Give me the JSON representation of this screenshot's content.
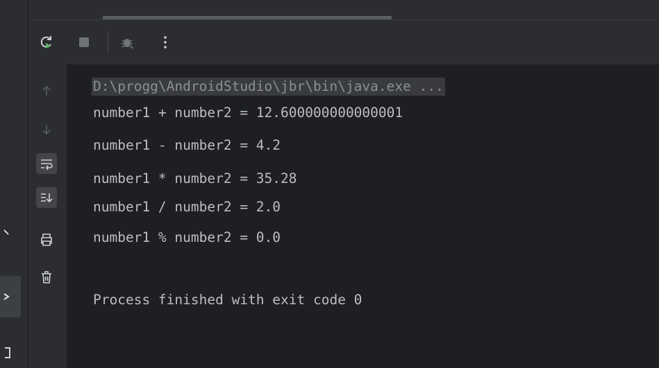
{
  "toolbar": {
    "buttons": [
      {
        "name": "rerun",
        "icon": "rerun-icon"
      },
      {
        "name": "stop",
        "icon": "stop-icon"
      },
      {
        "name": "debug",
        "icon": "debug-icon"
      },
      {
        "name": "more",
        "icon": "more-vertical-icon"
      }
    ]
  },
  "gutter": {
    "buttons": [
      {
        "name": "up",
        "icon": "arrow-up-icon",
        "active": false
      },
      {
        "name": "down",
        "icon": "arrow-down-icon",
        "active": false
      },
      {
        "name": "soft-wrap",
        "icon": "soft-wrap-icon",
        "active": true
      },
      {
        "name": "scroll-to-end",
        "icon": "scroll-to-end-icon",
        "active": true
      },
      {
        "name": "print",
        "icon": "print-icon",
        "active": false
      },
      {
        "name": "clear",
        "icon": "trash-icon",
        "active": false
      }
    ]
  },
  "console": {
    "command": "D:\\progg\\AndroidStudio\\jbr\\bin\\java.exe ...",
    "lines": [
      "number1 + number2 = 12.600000000000001",
      "number1 - number2 = 4.2",
      "number1 * number2 = 35.28",
      "number1 / number2 = 2.0",
      "number1 % number2 = 0.0",
      "",
      "Process finished with exit code 0"
    ]
  },
  "colors": {
    "background": "#1e1f22",
    "panel": "#2b2d30",
    "text": "#bcbec4",
    "rerun_accent": "#5fb865",
    "debug_icon": "#6f7277"
  }
}
